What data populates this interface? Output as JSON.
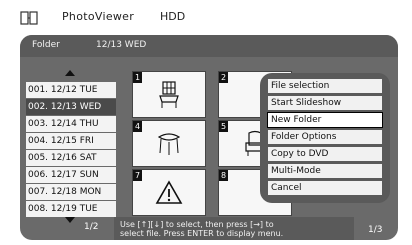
{
  "header": {
    "app_title": "PhotoViewer",
    "source": "HDD"
  },
  "subheader": {
    "folder_label": "Folder",
    "current_folder": "12/13 WED"
  },
  "folders": {
    "items": [
      "001. 12/12 TUE",
      "002. 12/13 WED",
      "003. 12/14 THU",
      "004. 12/15 FRI",
      "005. 12/16 SAT",
      "006. 12/17 SUN",
      "007. 12/18 MON",
      "008. 12/19 TUE"
    ],
    "selected_index": 1,
    "page": "1/2"
  },
  "thumbnails": {
    "labels": [
      "1",
      "2",
      "4",
      "5",
      "7",
      "8"
    ],
    "page": "1/3"
  },
  "menu": {
    "items": [
      "File selection",
      "Start Slideshow",
      "New Folder",
      "Folder Options",
      "Copy to DVD",
      "Multi-Mode",
      "Cancel"
    ],
    "selected_index": 2
  },
  "help": {
    "line1": "Use [↑][↓] to select, then press [→] to",
    "line2": "select file. Press ENTER to display menu."
  },
  "icons": {
    "app": "photo-icon",
    "arrow_up": "arrow-up-icon",
    "arrow_down": "arrow-down-icon"
  },
  "colors": {
    "panel": "#6a6a6a",
    "panel_dark": "#5a5a5a",
    "selected_bg": "#4a4a4a",
    "item_bg": "#f3f3f3"
  }
}
